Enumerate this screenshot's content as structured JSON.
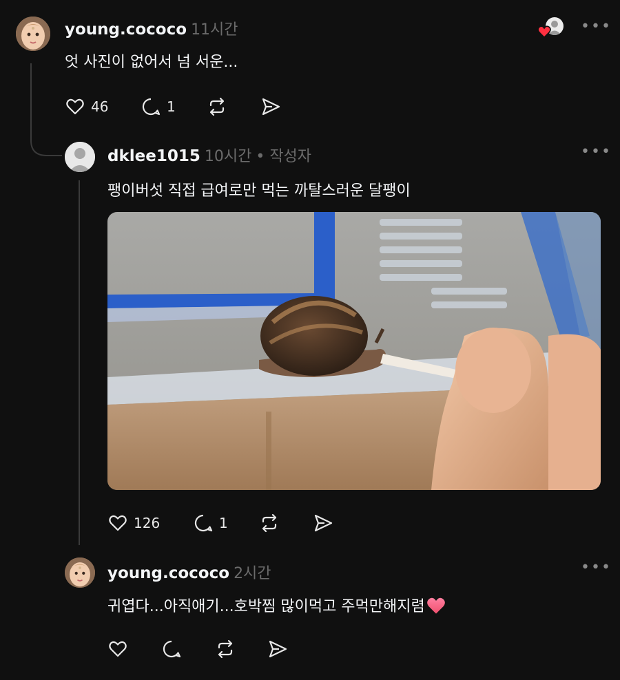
{
  "comments": [
    {
      "username": "young.cococo",
      "time": "11시간",
      "text": "엇 사진이 없어서 넘 서운...",
      "likes": "46",
      "replies": "1",
      "avatar_icon": "baby-avatar-icon"
    },
    {
      "username": "dklee1015",
      "time": "10시간",
      "author_tag": "• 작성자",
      "text": "팽이버섯 직접 급여로만 먹는 까탈스러운 달팽이",
      "likes": "126",
      "replies": "1",
      "photo_icon": "snail-photo-icon"
    },
    {
      "username": "young.cococo",
      "time": "2시간",
      "text": "귀엽다...아직애기...호박찜 많이먹고 주먹만해지렴",
      "emoji": "❤️"
    }
  ],
  "more_label": "•••",
  "colors": {
    "background": "#101010",
    "text": "#f3f5f7",
    "muted": "#6b6b6b",
    "heart": "#ff3040",
    "thread_line": "#3a3a3a"
  }
}
